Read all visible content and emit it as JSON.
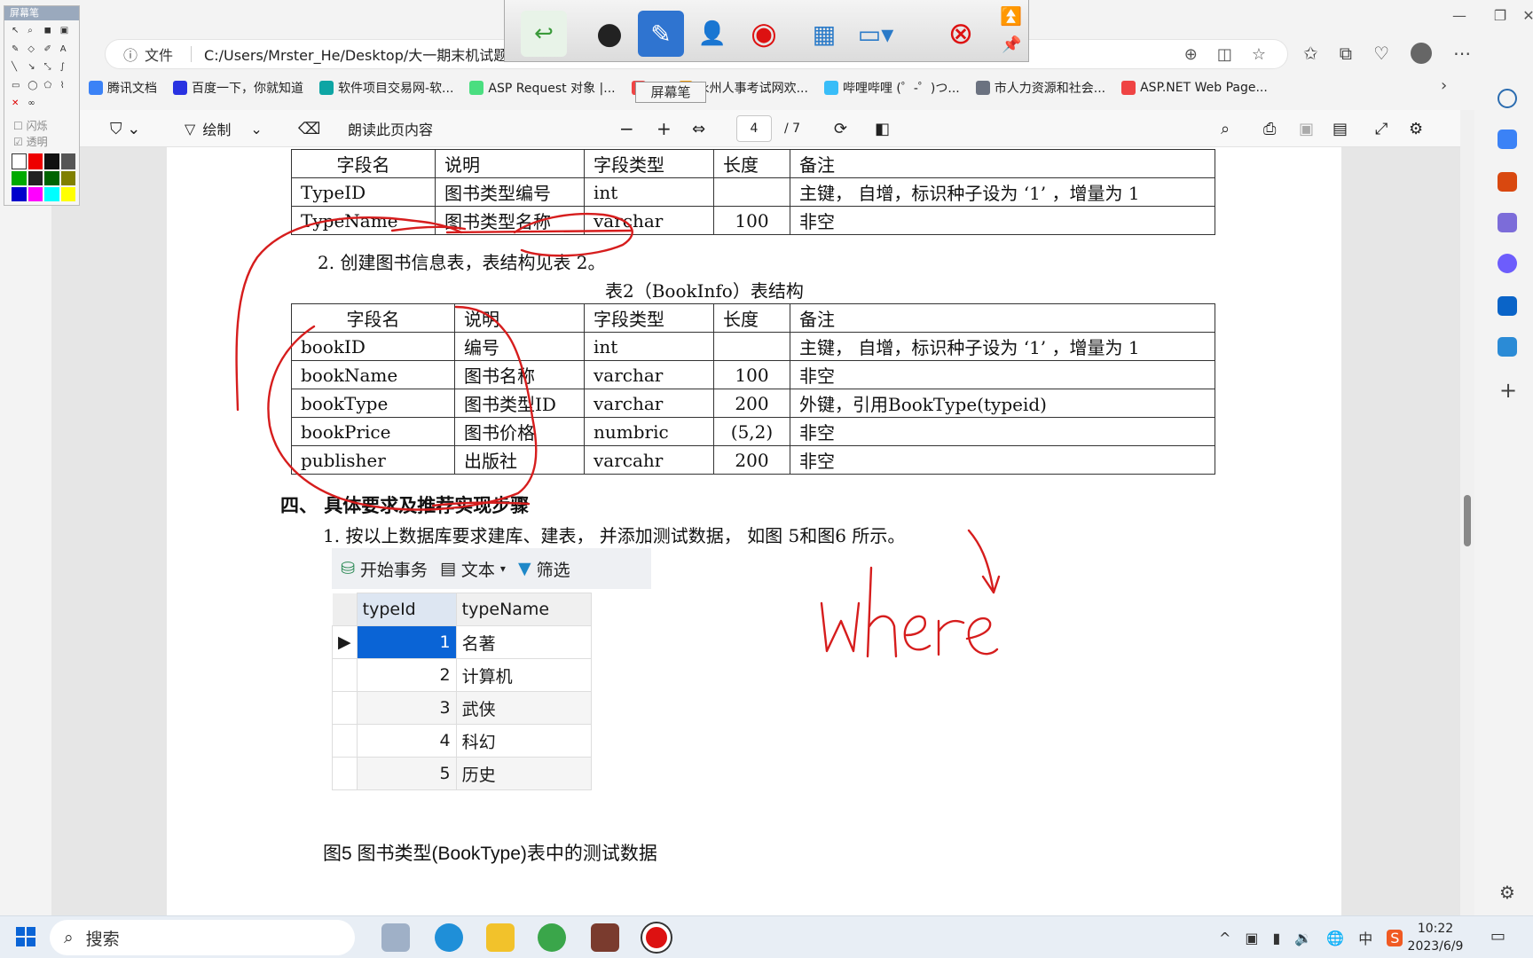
{
  "browser": {
    "address_info": "ⓘ",
    "address_label": "文件",
    "address_path": "C:/Users/Mrster_He/Desktop/大一期末机试题",
    "bookmarks": [
      {
        "label": "腾讯文档",
        "color": "#3b82f6"
      },
      {
        "label": "百度一下，你就知道",
        "color": "#2932e1"
      },
      {
        "label": "软件项目交易网-软...",
        "color": "#0ea5a4"
      },
      {
        "label": "ASP Request 对象 |...",
        "color": "#4ade80"
      },
      {
        "label": "图",
        "color": "#ef4444"
      },
      {
        "label": "永州人事考试网欢...",
        "color": "#f59e0b"
      },
      {
        "label": "哔哩哔哩 (゜-゜)つ...",
        "color": "#38bdf8"
      },
      {
        "label": "市人力资源和社会...",
        "color": "#6b7280"
      },
      {
        "label": "ASP.NET Web Page...",
        "color": "#ef4444"
      }
    ]
  },
  "pdf_toolbar": {
    "draw_label": "绘制",
    "read_aloud_label": "朗读此页内容",
    "minus": "−",
    "plus": "+",
    "page_current": "4",
    "page_total": "/ 7"
  },
  "doc": {
    "table1": {
      "headers": [
        "字段名",
        "说明",
        "字段类型",
        "长度",
        "备注"
      ],
      "rows": [
        [
          "TypeID",
          "图书类型编号",
          "int",
          "",
          "主键， 自增，标识种子设为 ‘1’ ，增量为 1"
        ],
        [
          "TypeName",
          "图书类型名称",
          "varchar",
          "100",
          "非空"
        ]
      ]
    },
    "step2": "2.   创建图书信息表，表结构见表 2。",
    "table2_caption": "表2（BookInfo）表结构",
    "table2": {
      "headers": [
        "字段名",
        "说明",
        "字段类型",
        "长度",
        "备注"
      ],
      "rows": [
        [
          "bookID",
          "编号",
          "int",
          "",
          "主键， 自增，标识种子设为 ‘1’ ，增量为 1"
        ],
        [
          "bookName",
          "图书名称",
          "varchar",
          "100",
          "非空"
        ],
        [
          "bookType",
          "图书类型ID",
          "varchar",
          "200",
          "外键，引用BookType(typeid)"
        ],
        [
          "bookPrice",
          "图书价格",
          "numbric",
          "(5,2)",
          "非空"
        ],
        [
          "publisher",
          "出版社",
          "varcahr",
          "200",
          "非空"
        ]
      ]
    },
    "section4": "四、  具体要求及推荐实现步骤",
    "step1": "1.   按以上数据库要求建库、建表， 并添加测试数据， 如图 5和图6 所示。",
    "figure5_caption": "图5 图书类型(BookType)表中的测试数据"
  },
  "navicat": {
    "begin_tx": "开始事务",
    "text": "文本",
    "filter": "筛选",
    "col_headers": [
      "typeId",
      "typeName"
    ],
    "rows": [
      [
        "1",
        "名著"
      ],
      [
        "2",
        "计算机"
      ],
      [
        "3",
        "武侠"
      ],
      [
        "4",
        "科幻"
      ],
      [
        "5",
        "历史"
      ]
    ]
  },
  "annotation": {
    "handwriting": "where",
    "tooltip": "屏幕笔",
    "panel_title": "屏幕笔",
    "flash_label": "闪烁",
    "transparent_label": "透明",
    "ink_color": "#d61d1d"
  },
  "taskbar": {
    "search_label": "搜索",
    "ime": "中",
    "time": "10:22",
    "date": "2023/6/9"
  }
}
